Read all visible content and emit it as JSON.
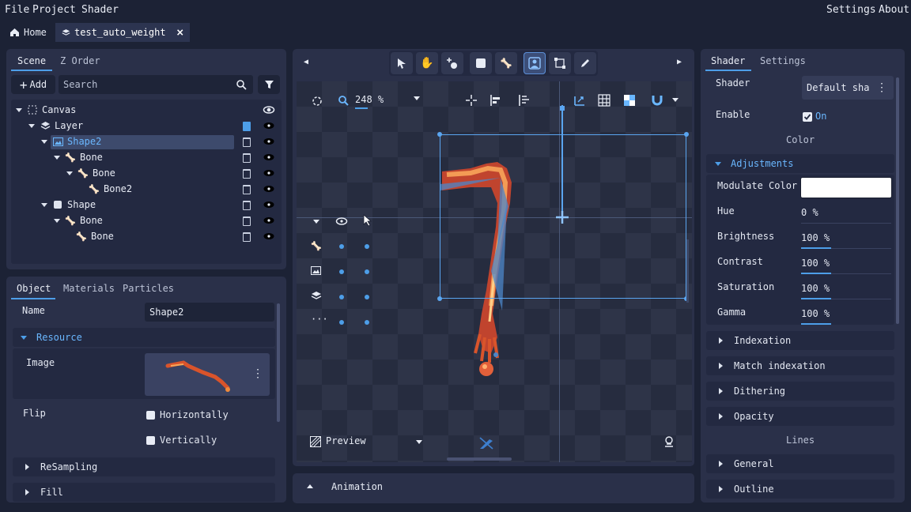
{
  "menu": {
    "file": "File",
    "project": "Project",
    "shader": "Shader",
    "settings": "Settings",
    "about": "About"
  },
  "tabs": {
    "home": "Home",
    "file": "test_auto_weight"
  },
  "scene_panel": {
    "tabs": [
      "Scene",
      "Z Order"
    ],
    "add_label": "Add",
    "search_placeholder": "Search",
    "tree": [
      {
        "label": "Canvas",
        "icon": "canvas-icon"
      },
      {
        "label": "Layer",
        "icon": "layer-icon"
      },
      {
        "label": "Shape2",
        "icon": "image-icon",
        "selected": true
      },
      {
        "label": "Bone",
        "icon": "bone-icon"
      },
      {
        "label": "Bone",
        "icon": "bone-icon"
      },
      {
        "label": "Bone2",
        "icon": "bone-icon"
      },
      {
        "label": "Shape",
        "icon": "shape-icon"
      },
      {
        "label": "Bone",
        "icon": "bone-icon"
      },
      {
        "label": "Bone",
        "icon": "bone-icon"
      }
    ]
  },
  "object_panel": {
    "tabs": [
      "Object",
      "Materials",
      "Particles"
    ],
    "name_label": "Name",
    "name_value": "Shape2",
    "resource_label": "Resource",
    "image_label": "Image",
    "flip_label": "Flip",
    "horizontally": "Horizontally",
    "vertically": "Vertically",
    "resampling": "ReSampling",
    "fill": "Fill"
  },
  "viewport": {
    "zoom": "248 %",
    "preview": "Preview",
    "animation": "Animation"
  },
  "shader_panel": {
    "tabs": [
      "Shader",
      "Settings"
    ],
    "shader_label": "Shader",
    "shader_value": "Default sha",
    "enable_label": "Enable",
    "enable_value": "On",
    "color_heading": "Color",
    "adjustments": "Adjustments",
    "modulate_color": "Modulate Color",
    "hue_label": "Hue",
    "hue_value": "0 %",
    "brightness_label": "Brightness",
    "brightness_value": "100 %",
    "contrast_label": "Contrast",
    "contrast_value": "100 %",
    "saturation_label": "Saturation",
    "saturation_value": "100 %",
    "gamma_label": "Gamma",
    "gamma_value": "100 %",
    "sections": [
      "Indexation",
      "Match indexation",
      "Dithering",
      "Opacity"
    ],
    "lines_heading": "Lines",
    "line_sections": [
      "General",
      "Outline"
    ]
  },
  "colors": {
    "accent": "#4d9ee8",
    "panel": "#2a3049",
    "background": "#1c2235"
  }
}
